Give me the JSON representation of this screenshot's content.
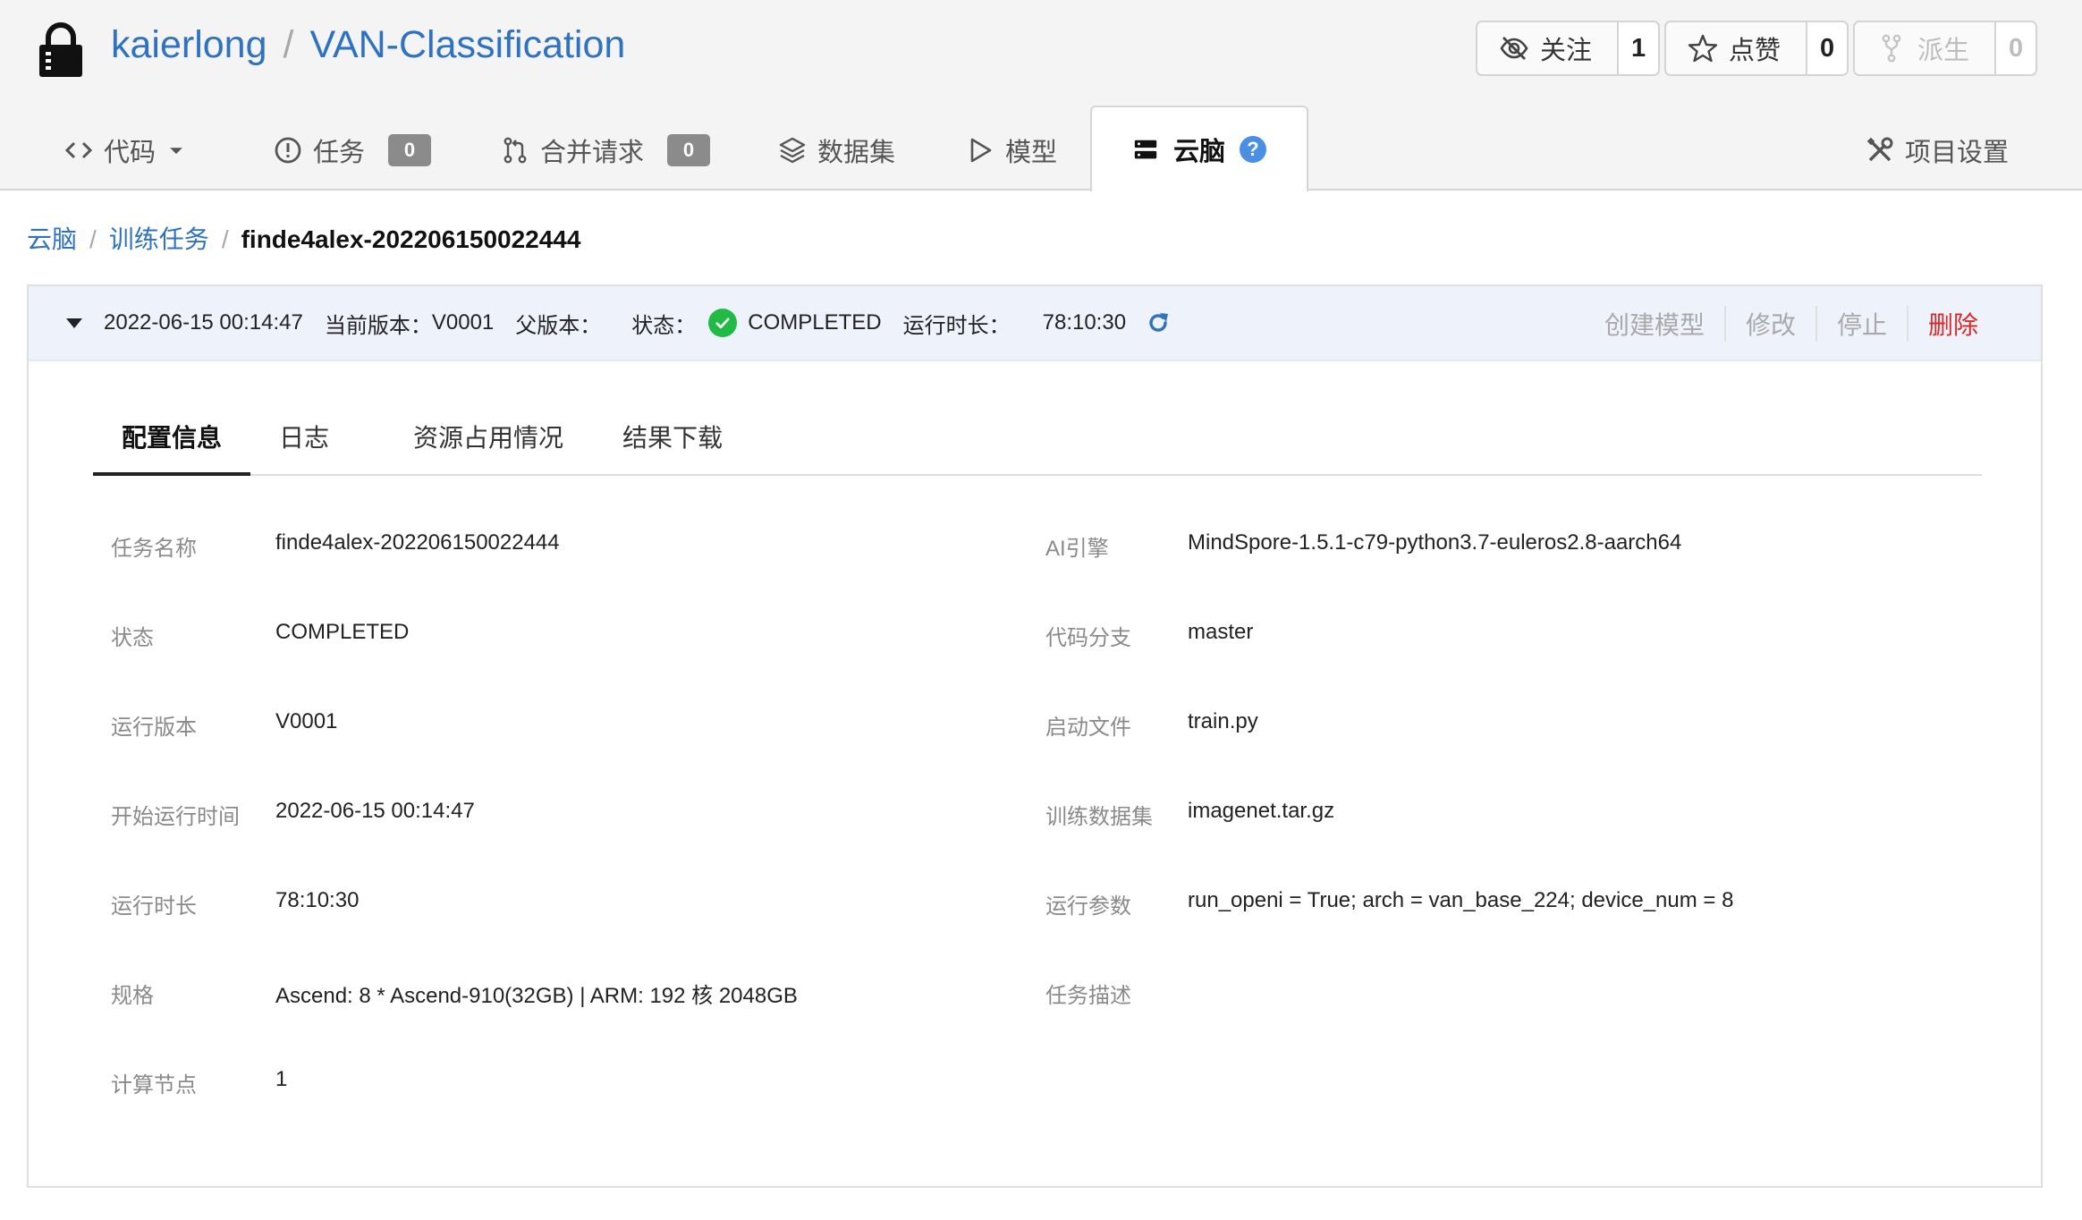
{
  "repo": {
    "owner": "kaierlong",
    "separator": "/",
    "name": "VAN-Classification"
  },
  "actions": [
    {
      "label": "关注",
      "count": "1",
      "icon": "eye-slash-icon",
      "disabled": false
    },
    {
      "label": "点赞",
      "count": "0",
      "icon": "star-icon",
      "disabled": false
    },
    {
      "label": "派生",
      "count": "0",
      "icon": "fork-icon",
      "disabled": true
    }
  ],
  "tabs": {
    "code": {
      "label": "代码",
      "icon": "code-icon"
    },
    "issues": {
      "label": "任务",
      "count": "0",
      "icon": "issue-icon"
    },
    "pulls": {
      "label": "合并请求",
      "count": "0",
      "icon": "pull-request-icon"
    },
    "datasets": {
      "label": "数据集",
      "icon": "layers-icon"
    },
    "models": {
      "label": "模型",
      "icon": "play-icon"
    },
    "cloudbrain": {
      "label": "云脑",
      "icon": "server-icon",
      "help": "?"
    },
    "settings": {
      "label": "项目设置",
      "icon": "tools-icon"
    }
  },
  "breadcrumb": {
    "root": "云脑",
    "section": "训练任务",
    "current": "finde4alex-202206150022444",
    "separator": "/"
  },
  "run": {
    "start_time": "2022-06-15 00:14:47",
    "version_label": "当前版本：",
    "version": "V0001",
    "parent_label": "父版本：",
    "status_label": "状态：",
    "status": "COMPLETED",
    "duration_label": "运行时长：",
    "duration": "78:10:30",
    "ops": {
      "create_model": "创建模型",
      "edit": "修改",
      "stop": "停止",
      "delete": "删除"
    }
  },
  "subtabs": [
    "配置信息",
    "日志",
    "资源占用情况",
    "结果下载"
  ],
  "details": {
    "left": [
      {
        "label": "任务名称",
        "value": "finde4alex-202206150022444"
      },
      {
        "label": "状态",
        "value": "COMPLETED"
      },
      {
        "label": "运行版本",
        "value": "V0001"
      },
      {
        "label": "开始运行时间",
        "value": "2022-06-15 00:14:47"
      },
      {
        "label": "运行时长",
        "value": "78:10:30"
      },
      {
        "label": "规格",
        "value": "Ascend: 8 * Ascend-910(32GB) | ARM: 192 核 2048GB"
      },
      {
        "label": "计算节点",
        "value": "1"
      }
    ],
    "right": [
      {
        "label": "AI引擎",
        "value": "MindSpore-1.5.1-c79-python3.7-euleros2.8-aarch64"
      },
      {
        "label": "代码分支",
        "value": "master"
      },
      {
        "label": "启动文件",
        "value": "train.py"
      },
      {
        "label": "训练数据集",
        "value": "imagenet.tar.gz"
      },
      {
        "label": "运行参数",
        "value": "run_openi = True; arch = van_base_224; device_num = 8"
      },
      {
        "label": "任务描述",
        "value": ""
      }
    ]
  },
  "colors": {
    "link": "#2f72c0",
    "success": "#21ba45",
    "danger": "#db2828",
    "run_bar_bg": "#eef3fb",
    "header_bg": "#f4f4f4"
  }
}
